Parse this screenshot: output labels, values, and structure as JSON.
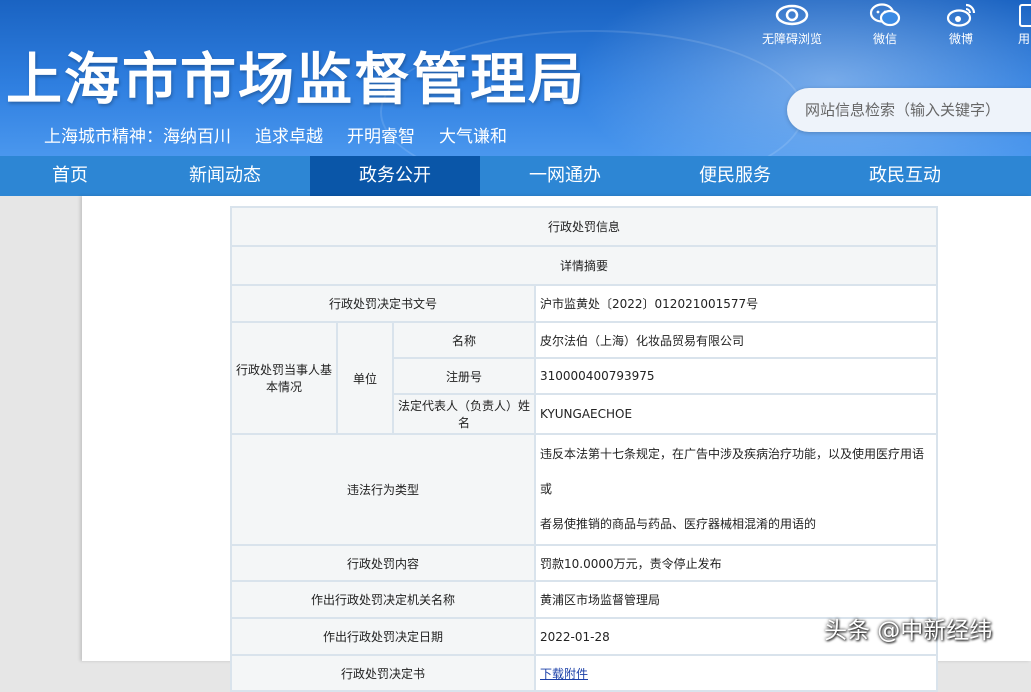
{
  "header": {
    "title": "上海市市场监督管理局",
    "slogan": [
      "上海城市精神：海纳百川",
      "追求卓越",
      "开明睿智",
      "大气谦和"
    ],
    "tools": [
      {
        "label": "无障碍浏览",
        "icon": "eye-icon"
      },
      {
        "label": "微信",
        "icon": "wechat-icon"
      },
      {
        "label": "微博",
        "icon": "weibo-icon"
      },
      {
        "label": "用",
        "icon": "mobile-icon"
      }
    ],
    "search": {
      "placeholder": "网站信息检索（输入关键字）",
      "value": ""
    },
    "colors": {
      "header_blue": "#2f7fe0",
      "nav_blue": "#2d86d4",
      "nav_active": "#0a56a8"
    }
  },
  "nav": {
    "items": [
      "首页",
      "新闻动态",
      "政务公开",
      "一网通办",
      "便民服务",
      "政民互动"
    ],
    "active": "政务公开"
  },
  "table": {
    "title": "行政处罚信息",
    "subtitle": "详情摘要",
    "doc_no_label": "行政处罚决定书文号",
    "doc_no": "沪市监黄处〔2022〕012021001577号",
    "party_label": "行政处罚当事人基本情况",
    "unit_label": "单位",
    "name_label": "名称",
    "name": "皮尔法伯（上海）化妆品贸易有限公司",
    "reg_label": "注册号",
    "reg": "310000400793975",
    "rep_label": "法定代表人（负责人）姓名",
    "rep": "KYUNGAECHOE",
    "violation_label": "违法行为类型",
    "violation_line1": "违反本法第十七条规定，在广告中涉及疾病治疗功能，以及使用医疗用语或",
    "violation_line2": "者易使推销的商品与药品、医疗器械相混淆的用语的",
    "content_label": "行政处罚内容",
    "content": "罚款10.0000万元，责令停止发布",
    "authority_label": "作出行政处罚决定机关名称",
    "authority": "黄浦区市场监督管理局",
    "date_label": "作出行政处罚决定日期",
    "date": "2022-01-28",
    "decision_label": "行政处罚决定书",
    "decision_link": "下载附件"
  },
  "watermark": "头条 @中新经纬"
}
